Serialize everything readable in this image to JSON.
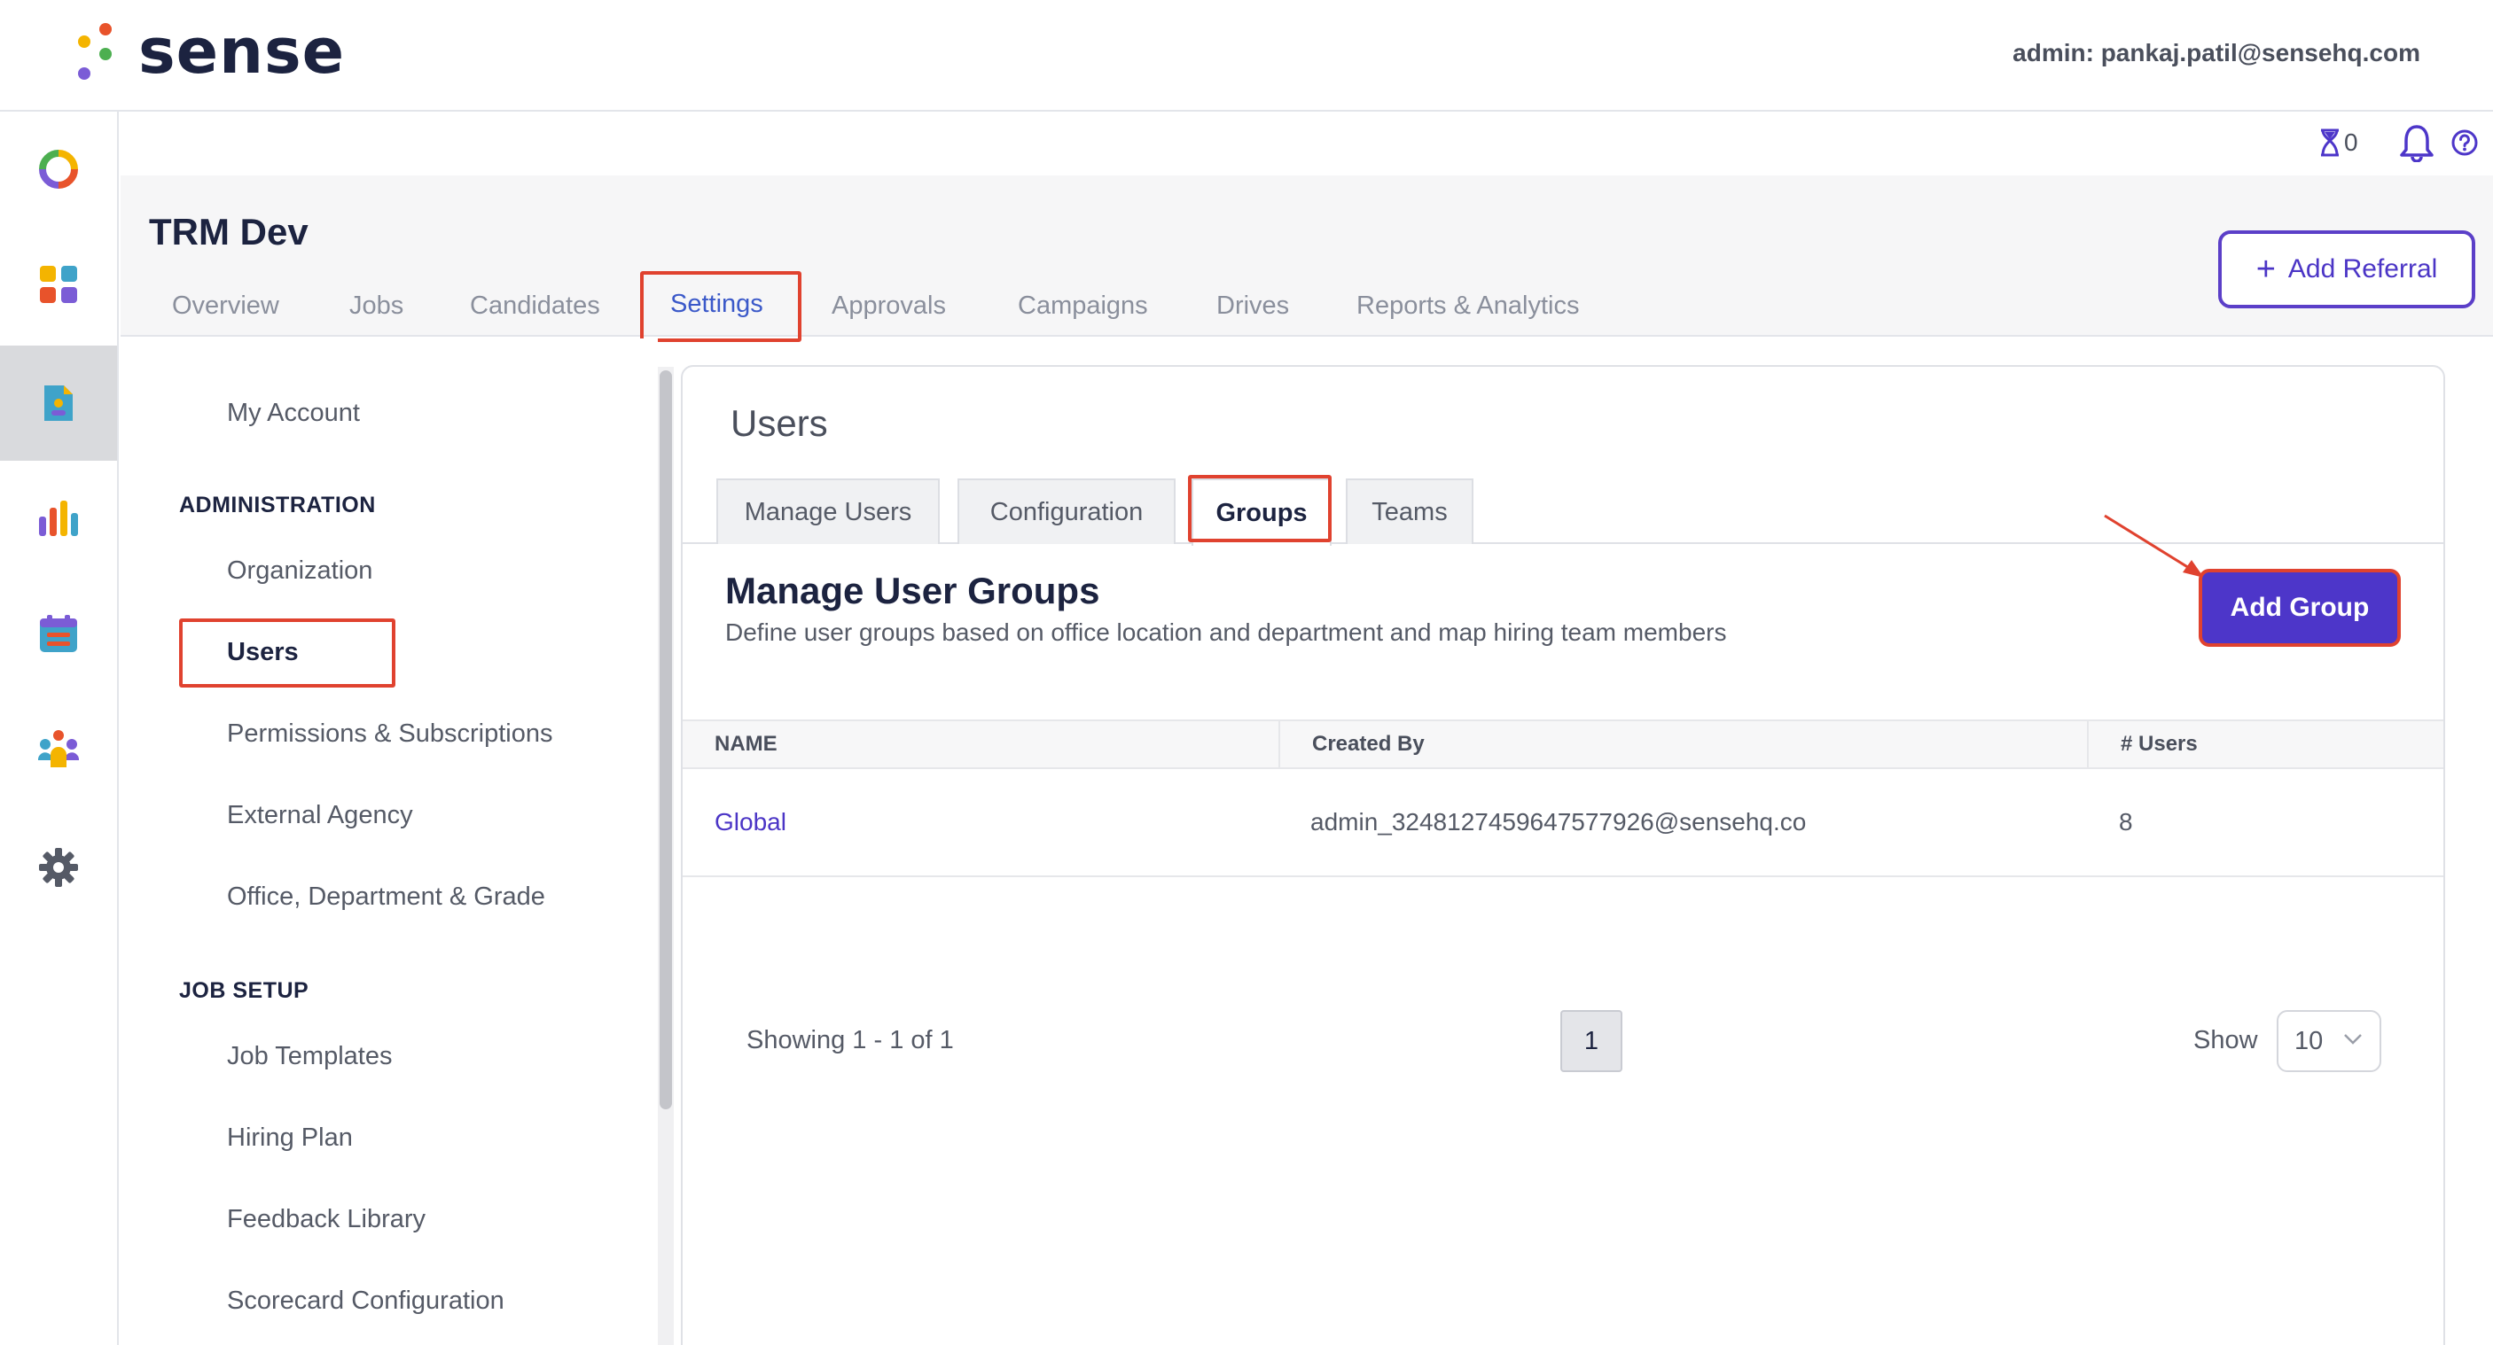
{
  "brand": {
    "name": "sense",
    "dot_colors": [
      "#f4b400",
      "#e8532b",
      "#4caf50",
      "#7b5cd6"
    ]
  },
  "header": {
    "admin_label": "admin: pankaj.patil@sensehq.com",
    "timer_count": "0",
    "icons": [
      "hourglass-icon",
      "bell-icon",
      "help-icon"
    ]
  },
  "rail": {
    "icons": [
      "dashboard-ring-icon",
      "apps-grid-icon",
      "jobs-document-icon",
      "analytics-bar-icon",
      "calendar-icon",
      "people-icon",
      "settings-gear-icon"
    ],
    "active_index": 2
  },
  "project": {
    "title": "TRM Dev",
    "tabs": [
      "Overview",
      "Jobs",
      "Candidates",
      "Settings",
      "Approvals",
      "Campaigns",
      "Drives",
      "Reports & Analytics"
    ],
    "active_tab": "Settings",
    "add_referral_label": "Add Referral"
  },
  "settings_nav": {
    "top_link": "My Account",
    "sections": [
      {
        "title": "ADMINISTRATION",
        "items": [
          "Organization",
          "Users",
          "Permissions & Subscriptions",
          "External Agency",
          "Office, Department & Grade"
        ]
      },
      {
        "title": "JOB SETUP",
        "items": [
          "Job Templates",
          "Hiring Plan",
          "Feedback Library",
          "Scorecard Configuration"
        ]
      }
    ],
    "active_item": "Users"
  },
  "users_panel": {
    "title": "Users",
    "tabs": [
      "Manage Users",
      "Configuration",
      "Groups",
      "Teams"
    ],
    "active_tab": "Groups",
    "section_title": "Manage User Groups",
    "section_desc": "Define user groups based on office location and department and map hiring team members",
    "add_group_label": "Add Group",
    "table": {
      "columns": [
        "NAME",
        "Created By",
        "# Users"
      ],
      "rows": [
        [
          "Global",
          "admin_3248127459647577926@sensehq.co",
          "8"
        ]
      ]
    },
    "pagination": {
      "showing": "Showing 1 - 1 of 1",
      "current_page": "1",
      "show_label": "Show",
      "page_size": "10"
    }
  },
  "colors": {
    "accent": "#4d36c9",
    "active_tab": "#3b59c9",
    "highlight": "#e0422f"
  }
}
